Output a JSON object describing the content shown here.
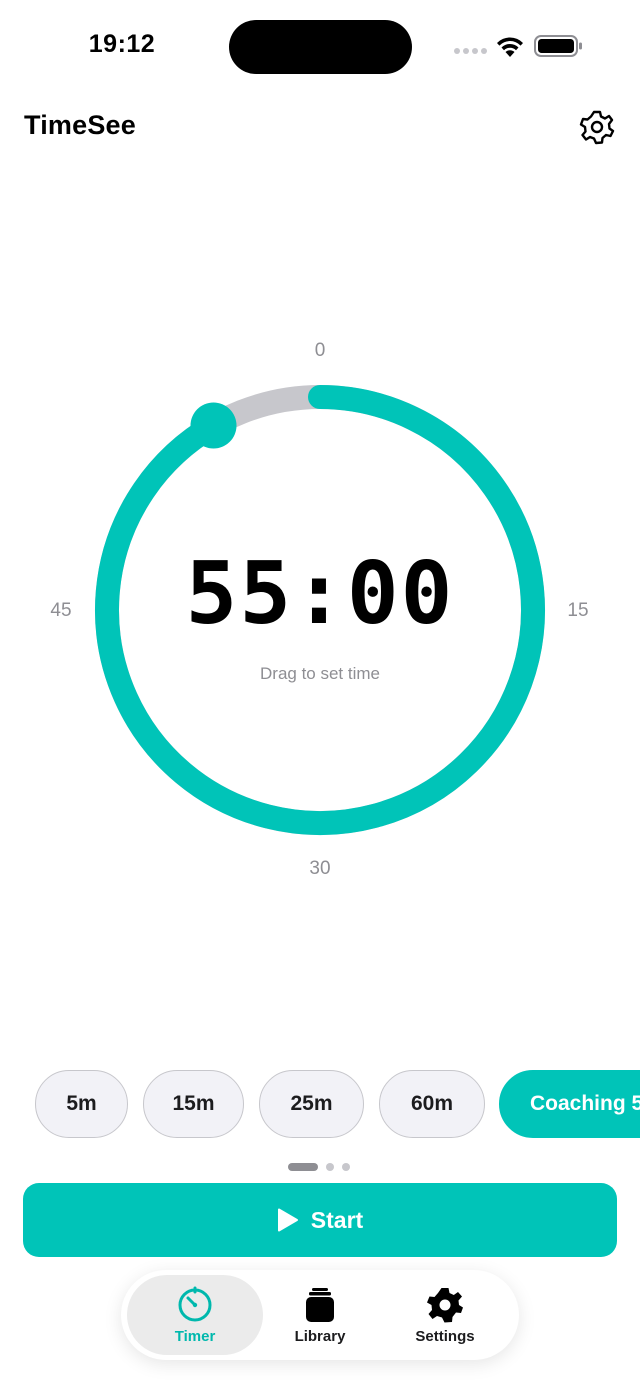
{
  "status_bar": {
    "time": "19:12",
    "icons": [
      "signal-dots-icon",
      "wifi-icon",
      "battery-icon"
    ]
  },
  "header": {
    "title": "TimeSee",
    "settings_icon": "gear-icon"
  },
  "dial": {
    "tick_labels": {
      "top": "0",
      "right": "15",
      "bottom": "30",
      "left": "45"
    },
    "time": "55:00",
    "hint": "Drag to set time",
    "max_minutes": 60,
    "set_minutes": 55,
    "progress_color": "#00c4b8",
    "track_color": "#c7c7cc"
  },
  "presets": {
    "items": [
      {
        "label": "5m",
        "selected": false
      },
      {
        "label": "15m",
        "selected": false
      },
      {
        "label": "25m",
        "selected": false
      },
      {
        "label": "60m",
        "selected": false
      },
      {
        "label": "Coaching 5",
        "selected": true
      }
    ]
  },
  "pager": {
    "pages": 3,
    "current": 1
  },
  "start_button": {
    "label": "Start",
    "icon": "play-icon"
  },
  "tab_bar": {
    "tabs": [
      {
        "label": "Timer",
        "icon": "timer-icon",
        "active": true
      },
      {
        "label": "Library",
        "icon": "library-icon",
        "active": false
      },
      {
        "label": "Settings",
        "icon": "gear-icon",
        "active": false
      }
    ]
  },
  "colors": {
    "accent": "#00c4b8",
    "chip_background": "#f2f2f7",
    "secondary_text": "#8e8e93"
  }
}
